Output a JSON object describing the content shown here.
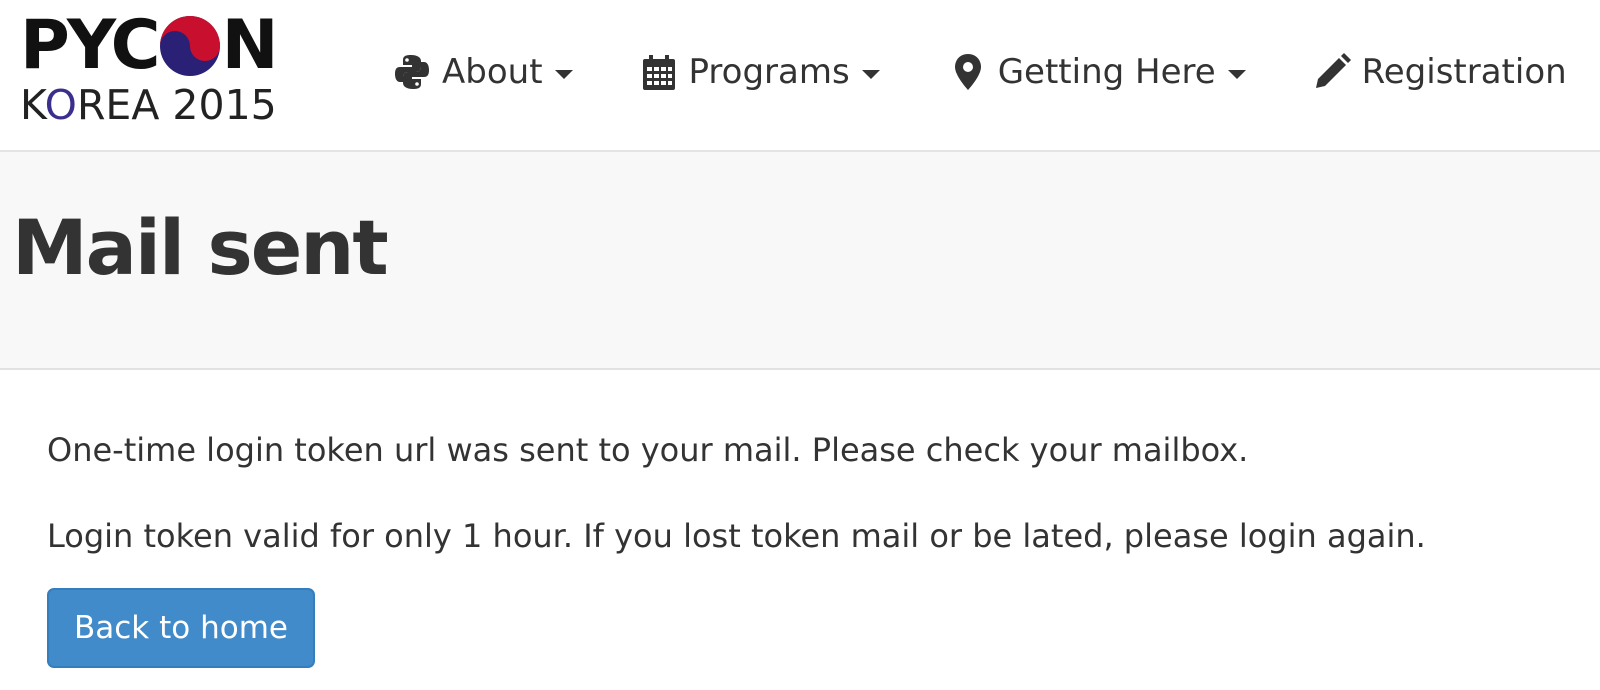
{
  "header": {
    "logo": {
      "line1": "PYCON",
      "line2": "KOREA 2015",
      "colors": {
        "red": "#c8102e",
        "blue": "#2a2075"
      }
    },
    "nav": [
      {
        "label": "About",
        "icon": "python-icon",
        "has_dropdown": true
      },
      {
        "label": "Programs",
        "icon": "calendar-icon",
        "has_dropdown": true
      },
      {
        "label": "Getting Here",
        "icon": "map-marker-icon",
        "has_dropdown": true
      },
      {
        "label": "Registration",
        "icon": "pencil-icon",
        "has_dropdown": false
      }
    ]
  },
  "page": {
    "title": "Mail sent",
    "messages": [
      "One-time login token url was sent to your mail. Please check your mailbox.",
      "Login token valid for only 1 hour. If you lost token mail or be lated, please login again."
    ],
    "back_button_label": "Back to home"
  },
  "colors": {
    "accent": "#428bca",
    "jumbotron_bg": "#f8f8f8",
    "text": "#333333"
  }
}
